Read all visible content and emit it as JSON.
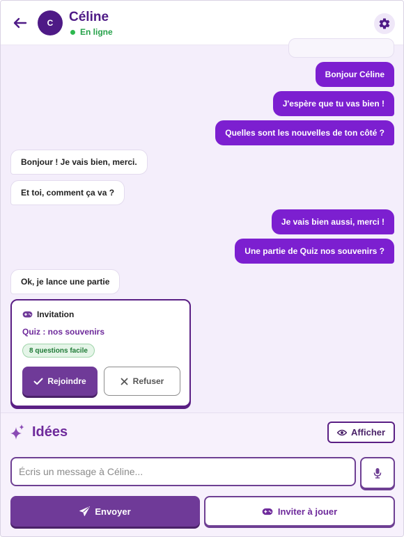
{
  "header": {
    "avatar_initial": "C",
    "contact_name": "Céline",
    "status": "En ligne"
  },
  "messages": [
    {
      "from": "me",
      "text": "Bonjour Céline"
    },
    {
      "from": "me",
      "text": "J'espère que tu vas bien !"
    },
    {
      "from": "me",
      "text": "Quelles sont les nouvelles de ton côté ?"
    },
    {
      "from": "them",
      "text": "Bonjour ! Je vais bien, merci."
    },
    {
      "from": "them",
      "text": "Et toi, comment ça va ?"
    },
    {
      "from": "me",
      "text": "Je vais bien aussi, merci !"
    },
    {
      "from": "me",
      "text": "Une partie de Quiz nos souvenirs ?"
    },
    {
      "from": "them",
      "text": "Ok, je lance une partie"
    }
  ],
  "invitation": {
    "heading": "Invitation",
    "title": "Quiz : nos souvenirs",
    "badge": "8 questions facile",
    "join_label": "Rejoindre",
    "refuse_label": "Refuser"
  },
  "ideas": {
    "label": "Idées",
    "show_label": "Afficher"
  },
  "composer": {
    "placeholder": "Écris un message à Céline...",
    "value": "",
    "send_label": "Envoyer",
    "invite_label": "Inviter à jouer"
  },
  "colors": {
    "brand": "#6f3a98",
    "outgoing_bubble": "#7c1fd0",
    "online": "#2db84f",
    "background": "#f4eefb"
  },
  "icons": {
    "back": "arrow-left-icon",
    "settings": "gear-icon",
    "invitation": "gamepad-icon",
    "join": "check-icon",
    "refuse": "close-icon",
    "ideas": "sparkles-icon",
    "show": "eye-icon",
    "mic": "microphone-icon",
    "send": "paper-plane-icon",
    "invite": "gamepad-icon"
  }
}
